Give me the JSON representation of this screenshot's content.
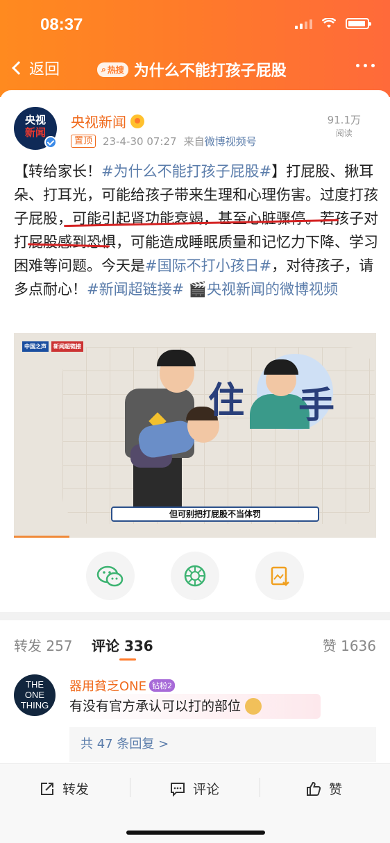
{
  "status_bar": {
    "time": "08:37"
  },
  "nav": {
    "back_label": "返回",
    "hot_badge": "热搜",
    "title": "为什么不能打孩子屁股"
  },
  "post": {
    "author": "央视新闻",
    "avatar_text_top": "央视",
    "avatar_text_bottom": "新闻",
    "pinned_label": "置顶",
    "date": "23-4-30 07:27",
    "source_prefix": "来自",
    "source": "微博视频号",
    "reads": "91.1万",
    "reads_label": "阅读",
    "text_parts": [
      {
        "t": "【转给家长！",
        "tag": false
      },
      {
        "t": "#为什么不能打孩子屁股#",
        "tag": true
      },
      {
        "t": "】打屁股、揪耳朵、打耳光，可能给孩子带来生理和心理伤害。过度打孩子屁股，可能引起肾功能衰竭，甚至心脏骤停。若孩子对打屁股感到恐惧，可能造成睡眠质量和记忆力下降、学习困难等问题。今天是",
        "tag": false
      },
      {
        "t": "#国际不打小孩日#",
        "tag": true
      },
      {
        "t": "，对待孩子，请多点耐心！",
        "tag": false
      },
      {
        "t": "#新闻超链接#",
        "tag": true
      },
      {
        "t": " ",
        "tag": false
      },
      {
        "t": "🎬央视新闻的微博视频",
        "tag": true
      }
    ]
  },
  "video": {
    "logo_left": "中国之声",
    "logo_right": "新闻超链接",
    "stop_left": "住",
    "stop_right": "手",
    "caption": "但可别把打屁股不当体罚"
  },
  "share": {
    "icons": [
      "wechat-icon",
      "moments-icon",
      "save-image-icon"
    ]
  },
  "tabs": {
    "repost": "转发 257",
    "comment": "评论 336",
    "like": "赞 1636"
  },
  "comment": {
    "avatar_text": [
      "THE",
      "ONE",
      "THING"
    ],
    "user": "器用貧乏ONE",
    "fan_badge": "钻粉2",
    "text": "有没有官方承认可以打的部位",
    "replies": "共 47 条回复 >"
  },
  "bottom_bar": {
    "repost": "转发",
    "comment": "评论",
    "like": "赞"
  },
  "colors": {
    "accent": "#ff7a2a",
    "link": "#5b7dab",
    "author": "#f06a1c"
  }
}
